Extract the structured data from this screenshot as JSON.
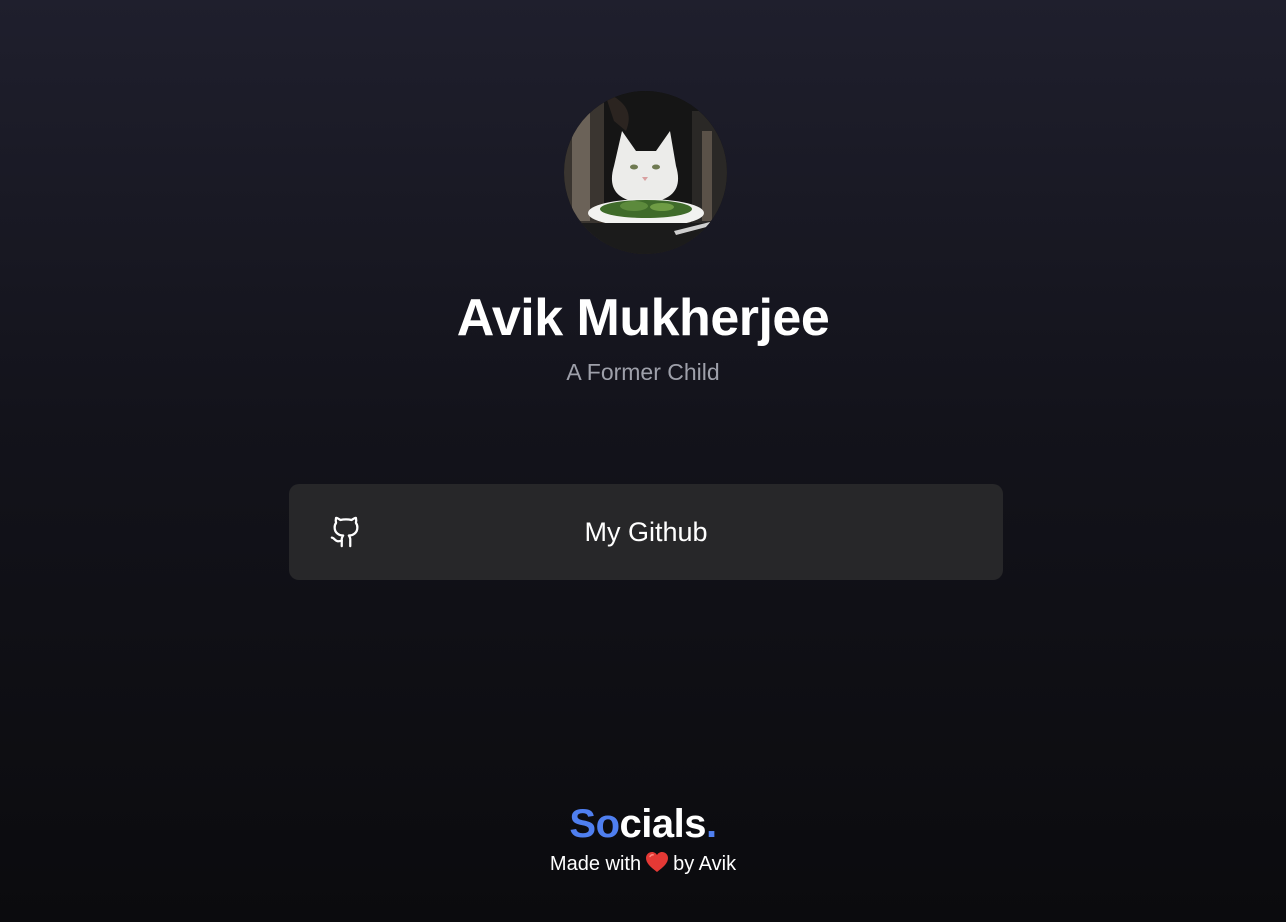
{
  "profile": {
    "name": "Avik Mukherjee",
    "tagline": "A Former Child"
  },
  "links": [
    {
      "label": "My Github",
      "icon": "github-icon"
    }
  ],
  "footer": {
    "brand_accent": "So",
    "brand_rest": "cials",
    "brand_dot": ".",
    "made_with": "Made with",
    "by": "by Avik",
    "heart_icon": "heart-icon"
  },
  "colors": {
    "accent": "#4f7ff0",
    "card": "#272729",
    "heart": "#e53935"
  }
}
